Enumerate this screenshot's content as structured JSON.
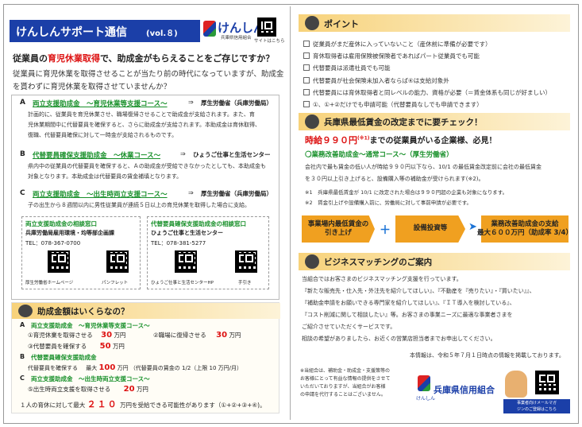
{
  "left": {
    "header": {
      "title": "けんしんサポート通信",
      "vol": "(vol.８)",
      "logo_text": "けんしん",
      "logo_sub": "兵庫県信用組合",
      "site": "サイトはこちら"
    },
    "intro": {
      "line1_a": "従業員の",
      "line1_b": "育児休業取得",
      "line1_c": "で、助成金がもらえることをご存じですか？",
      "line2": "従業員に育児休業を取得させることが当たり前の時代になっていますが、助成金",
      "line3": "を貰わずに育児休業を取得させていませんか？"
    },
    "A": {
      "letter": "A",
      "title": "両立支援助成金　～育児休業等支援コース～",
      "arrow": "⇒",
      "org": "厚生労働省（兵庫労働局）",
      "desc1": "計画的に、従業員を育児休業させ、職場復帰させることで助成金が支給されます。また、育",
      "desc2": "児休業期間中に代替要員を確保すると、さらに助成金が支給されます。本助成金は育休取得、",
      "desc3": "復職、代替要員確保に対して一時金が支給されるものです。"
    },
    "B": {
      "letter": "B",
      "title": "代替要員確保支援助成金　～休業コース～",
      "arrow": "⇒",
      "org": "ひょうご仕事と生活センター",
      "desc1": "県内中の従業員の代替要員を確保すると、Ａの助成金が受給できなかったとしても、本助成金も",
      "desc2": "対象となります。本助成金は代替要員の賃金補填となります。"
    },
    "C": {
      "letter": "C",
      "title": "両立支援助成金　～出生時両立支援コース～",
      "arrow": "⇒",
      "org": "厚生労働省（兵庫労働局）",
      "desc1": "子の出生から８週間以内に男性従業員が連続５日以上の育児休業を取得した場合に支給。"
    },
    "contact1": {
      "title": "両立支援助成金の相談窓口",
      "org": "兵庫労働局雇用環境・均等部企画課",
      "tel": "TEL：078-367-0700",
      "qr1": "厚生労働省ホームページ",
      "qr2": "パンフレット"
    },
    "contact2": {
      "title": "代替要員確保支援助成金の相談窓口",
      "org": "ひょうご仕事と生活センター",
      "tel": "TEL：078-381-5277",
      "qr1": "ひょうご仕事と生活センターHP",
      "qr2": "手引き"
    },
    "amount": {
      "heading": "助成金額はいくらなの？",
      "A_title": "両立支援助成金　～育児休業等支援コース～",
      "A1_label": "①育児休業を取得させる",
      "A1_val": "30",
      "A1_unit": "万円",
      "A2_label": "②職場に復帰させる",
      "A2_val": "30",
      "A2_unit": "万円",
      "A3_label": "③代替要員を確保する",
      "A3_val": "50",
      "A3_unit": "万円",
      "B_title": "代替要員確保支援助成金",
      "B_label": "代替要員を確保する",
      "B_mid": "最大",
      "B_val": "100",
      "B_unit": "万円",
      "B_note": "（代替要員の賃金の 1/2（上限 10 万円/月）",
      "C_title": "両立支援助成金　～出生時両立支援コース～",
      "C_label": "⑤出生時両立支援を取得させる",
      "C_val": "20",
      "C_unit": "万円",
      "total_a": "１人の育休に対して最大",
      "total_val": "２１０",
      "total_b": "万円を受給できる可能性があります（①+②+③+④)。"
    }
  },
  "right": {
    "points": {
      "heading": "ポイント",
      "items": [
        "従業員がまだ産休に入っていないこと（産休前に準備が必要です）",
        "育休取得者は雇用保険被保険者であればパート従業員でも可能",
        "代替要員は派遣社員でも可能",
        "代替要員が社会保険未加入者ならば④は支給対象外",
        "代替要員には育休取得者と同レベルの能力、資格が必要（＝賃金体系も同じが好ましい）",
        "①、①+②だけでも申請可能（代替要員なしでも申請できます）"
      ]
    },
    "minwage": {
      "heading": "兵庫県最低賃金の改定までに要チェック！",
      "hl_a": "時給９９０円",
      "hl_sup": "(※1)",
      "hl_b": "までの従業員がいる企業様、必見！",
      "course": "〇業務改善助成金～通常コース～（厚生労働省）",
      "desc1": "会社内で最も賃金の低い人が時給９９０円以下なら、10/1 の最低賃金改定前に会社の最低賃金",
      "desc2": "を３０円以上引き上げると、設備購入等の補助金が受けられます(※2)。",
      "note1": "※1　兵庫県最低賃金が 10/1 に改定された場合は９９０円超の企業も対象になります。",
      "note2": "※2　賃金引上げや設備購入前に、労働局に対して事前申請が必要です。",
      "flow1": "事業場内最低賃金の\n引き上げ",
      "plus": "＋",
      "flow2": "設備投資等",
      "flow3": "業務改善助成金の支給\n最大６００万円（助成率 3/4）"
    },
    "biz": {
      "heading": "ビジネスマッチングのご案内",
      "l1": "当組合ではお客さまのビジネスマッチング支援を行っています。",
      "l2": "『新たな販売先・仕入先・外注先を紹介してほしい』、『不動産を『売りたい』・『買いたい』』、",
      "l3": "『補助金申請をお願いできる専門家を紹介してほしい』、『ＩＴ導入を検討している』、",
      "l4": "『コスト削減に関して相談したい』等。お客さまの事業ニーズに最適な事業者さまを",
      "l5": "ご紹介させていただくサービスです。",
      "l6": "相談の希望がありましたら、お近くの営業店担当者までお申出してください。"
    },
    "info_date": "本情報は、令和５年７月１日時点の情報を掲載しております。",
    "footer": {
      "n1": "※当組合は、補助金・助成金・支援策等の",
      "n2": "お客様にとって有益な情報の提供をさせて",
      "n3": "いただいておりますが、当組合がお客様",
      "n4": "の申請を代行することはございません。",
      "logo": "兵庫県信用組合",
      "logo_sub": "けんしん",
      "mail": "事業者向けメールマガ",
      "mail2": "ジンのご登録はこちら"
    }
  }
}
